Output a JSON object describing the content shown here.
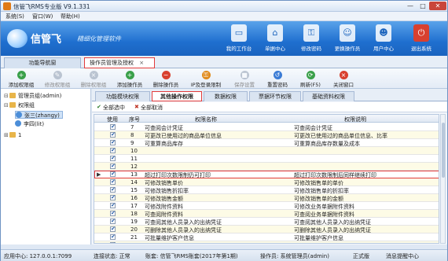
{
  "app_title": "信管飞RMS专业版 V9.1.331",
  "window_controls": {
    "minimize": "—",
    "maximize": "□",
    "close": "✕"
  },
  "menu": [
    "系统(S)",
    "窗口(W)",
    "帮助(H)"
  ],
  "brand": {
    "name": "信管飞",
    "slogan": "精细化管理软件"
  },
  "toolbar": [
    {
      "label": "我的工作台",
      "icon": "monitor-icon"
    },
    {
      "label": "单据中心",
      "icon": "home-icon"
    },
    {
      "label": "修改密码",
      "icon": "key-icon"
    },
    {
      "label": "更换操作员",
      "icon": "users-icon"
    },
    {
      "label": "用户中心",
      "icon": "user-icon"
    },
    {
      "label": "退出系统",
      "icon": "power-icon"
    }
  ],
  "doc_tabs": [
    {
      "label": "功能导航窗"
    },
    {
      "label": "操作员管理及授权",
      "close": "×"
    }
  ],
  "actions": [
    {
      "label": "添加权限组",
      "disabled": false,
      "color": "#3aa04a",
      "glyph": "+"
    },
    {
      "label": "修改权限组",
      "disabled": true,
      "color": "#7a8aa0",
      "glyph": "✎"
    },
    {
      "label": "删除权限组",
      "disabled": true,
      "color": "#7a8aa0",
      "glyph": "×"
    },
    {
      "label": "添加操作员",
      "disabled": false,
      "color": "#3aa04a",
      "glyph": "+"
    },
    {
      "label": "删除操作员",
      "disabled": false,
      "color": "#d8402f",
      "glyph": "−"
    },
    {
      "label": "IP及登录限制",
      "disabled": false,
      "color": "#e08a1c",
      "glyph": "⚿"
    },
    {
      "label": "保存设置",
      "disabled": true,
      "color": "#7a8aa0",
      "glyph": "■"
    },
    {
      "label": "重置密码",
      "disabled": false,
      "color": "#3a7bd5",
      "glyph": "↺"
    },
    {
      "label": "刷新(F5)",
      "disabled": false,
      "color": "#3aa04a",
      "glyph": "⟳"
    },
    {
      "label": "关闭窗口",
      "disabled": false,
      "color": "#d8402f",
      "glyph": "×"
    }
  ],
  "tree": [
    {
      "label": "管理员组(admin)",
      "level": 0,
      "type": "group",
      "toggle": "⊟"
    },
    {
      "label": "权限组",
      "level": 0,
      "type": "group",
      "toggle": "⊟"
    },
    {
      "label": "张三(zhangy)",
      "level": 1,
      "type": "user",
      "selected": true
    },
    {
      "label": "李四(lit)",
      "level": 1,
      "type": "user"
    },
    {
      "label": "1",
      "level": 0,
      "type": "group",
      "toggle": "⊞"
    }
  ],
  "inner_tabs": [
    "功能模块权限",
    "其他操作权限",
    "数据权限",
    "票据环节权限",
    "基础资料权限"
  ],
  "inner_active": 1,
  "subbar": {
    "select_all": "全部选中",
    "cancel_all": "全部取消"
  },
  "grid": {
    "headers": [
      "使用",
      "序号",
      "权限名称",
      "权限说明"
    ],
    "rows": [
      {
        "use": true,
        "no": "7",
        "name": "可查阅会计凭证",
        "desc": "可查阅会计凭证"
      },
      {
        "use": true,
        "no": "8",
        "name": "可更改已使用过的商品单位信息",
        "desc": "可更改已使用过的商品单位信息、比率"
      },
      {
        "use": true,
        "no": "9",
        "name": "可重算商品库存",
        "desc": "可重算商品库存数量及成本"
      },
      {
        "use": true,
        "no": "10",
        "name": "",
        "desc": ""
      },
      {
        "use": true,
        "no": "11",
        "name": "",
        "desc": ""
      },
      {
        "use": true,
        "no": "12",
        "name": "",
        "desc": ""
      },
      {
        "use": true,
        "no": "13",
        "name": "超过打印次数限制仍可打印",
        "desc": "超过打印次数限制后同样继续打印",
        "highlight": true
      },
      {
        "use": true,
        "no": "14",
        "name": "可修改销售单价",
        "desc": "可修改销售单的单价"
      },
      {
        "use": true,
        "no": "15",
        "name": "可修改销售折扣率",
        "desc": "可修改销售单的折扣率"
      },
      {
        "use": true,
        "no": "16",
        "name": "可修改销售金额",
        "desc": "可修改销售单的金额"
      },
      {
        "use": true,
        "no": "17",
        "name": "可修改附件资料",
        "desc": "可修改业务单据附件资料"
      },
      {
        "use": true,
        "no": "18",
        "name": "可查阅附件资料",
        "desc": "可查阅业务单据附件资料"
      },
      {
        "use": true,
        "no": "19",
        "name": "可查阅其他人员录入的出纳凭证",
        "desc": "可查阅其他人员录入的出纳凭证"
      },
      {
        "use": true,
        "no": "20",
        "name": "可删除其他人员录入的出纳凭证",
        "desc": "可删除其他人员录入的出纳凭证"
      },
      {
        "use": true,
        "no": "21",
        "name": "可批量维护客户信息",
        "desc": "可批量维护客户信息"
      },
      {
        "use": true,
        "no": "22",
        "name": "可批量维护商品信息",
        "desc": "可批量维护商品信息"
      }
    ]
  },
  "status": {
    "server": "应用中心: 127.0.0.1:7099",
    "conn": "连接状态: 正常",
    "account": "账套: 信管飞RMS账套(2017年第1期)",
    "operator": "操作员: 系统管理员(admin)",
    "version": "正式版",
    "news": "消息提醒中心"
  },
  "colors": {
    "banner": "#1f6fcf",
    "highlight_border": "#e23b3b",
    "selection": "#cfe2f7"
  }
}
